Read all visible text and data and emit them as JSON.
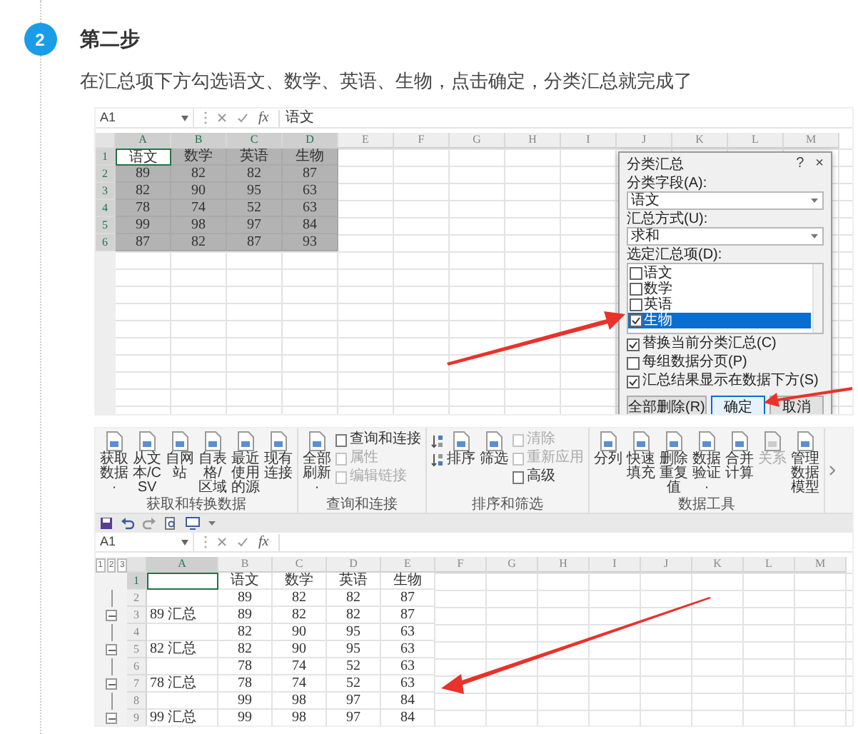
{
  "step": {
    "number": "2",
    "title": "第二步",
    "description": "在汇总项下方勾选语文、数学、英语、生物，点击确定，分类汇总就完成了"
  },
  "screenshot_1": {
    "formula_bar": {
      "name_box": "A1",
      "fx": "fx",
      "value": "语文"
    },
    "columns": [
      {
        "label": "A",
        "selected": true
      },
      {
        "label": "B",
        "selected": true
      },
      {
        "label": "C",
        "selected": true
      },
      {
        "label": "D",
        "selected": true
      },
      {
        "label": "E",
        "selected": false
      },
      {
        "label": "F",
        "selected": false
      },
      {
        "label": "G",
        "selected": false
      },
      {
        "label": "H",
        "selected": false
      },
      {
        "label": "I",
        "selected": false
      },
      {
        "label": "J",
        "selected": false
      },
      {
        "label": "K",
        "selected": false
      },
      {
        "label": "L",
        "selected": false
      },
      {
        "label": "M",
        "selected": false
      }
    ],
    "rows": [
      {
        "num": "1",
        "selected": true,
        "active": true,
        "cells": [
          "语文",
          "数学",
          "英语",
          "生物"
        ]
      },
      {
        "num": "2",
        "selected": true,
        "active": false,
        "cells": [
          "89",
          "82",
          "82",
          "87"
        ]
      },
      {
        "num": "3",
        "selected": true,
        "active": false,
        "cells": [
          "82",
          "90",
          "95",
          "63"
        ]
      },
      {
        "num": "4",
        "selected": true,
        "active": false,
        "cells": [
          "78",
          "74",
          "52",
          "63"
        ]
      },
      {
        "num": "5",
        "selected": true,
        "active": false,
        "cells": [
          "99",
          "98",
          "97",
          "84"
        ]
      },
      {
        "num": "6",
        "selected": true,
        "active": false,
        "cells": [
          "87",
          "82",
          "87",
          "93"
        ]
      }
    ],
    "dialog": {
      "title": "分类汇总",
      "help": "?",
      "close": "×",
      "field_label": "分类字段(A):",
      "field_value": "语文",
      "method_label": "汇总方式(U):",
      "method_value": "求和",
      "items_label": "选定汇总项(D):",
      "items": [
        {
          "label": "语文",
          "checked": false,
          "selected": false
        },
        {
          "label": "数学",
          "checked": false,
          "selected": false
        },
        {
          "label": "英语",
          "checked": false,
          "selected": false
        },
        {
          "label": "生物",
          "checked": true,
          "selected": true
        }
      ],
      "options": [
        {
          "label": "替换当前分类汇总(C)",
          "checked": true
        },
        {
          "label": "每组数据分页(P)",
          "checked": false
        },
        {
          "label": "汇总结果显示在数据下方(S)",
          "checked": true
        }
      ],
      "buttons": [
        {
          "label": "全部删除(R)",
          "selected": false
        },
        {
          "label": "确定",
          "selected": true
        },
        {
          "label": "取消",
          "selected": false
        }
      ]
    }
  },
  "screenshot_2": {
    "ribbon": {
      "groups": [
        {
          "label": "获取和转换数据",
          "items": [
            {
              "kind": "large",
              "label": "获取数据·",
              "disabled": false
            },
            {
              "kind": "large",
              "label": "从文本/CSV",
              "disabled": false
            },
            {
              "kind": "large",
              "label": "自网站",
              "disabled": false
            },
            {
              "kind": "large",
              "label": "自表格/区域",
              "disabled": false
            },
            {
              "kind": "large",
              "label": "最近使用的源",
              "disabled": false
            },
            {
              "kind": "large",
              "label": "现有连接",
              "disabled": false
            }
          ]
        },
        {
          "label": "查询和连接",
          "items": [
            {
              "kind": "large",
              "label": "全部刷新·",
              "disabled": false
            },
            {
              "kind": "small",
              "label": "查询和连接",
              "disabled": false
            },
            {
              "kind": "small",
              "label": "属性",
              "disabled": true
            },
            {
              "kind": "small",
              "label": "编辑链接",
              "disabled": true
            }
          ]
        },
        {
          "label": "排序和筛选",
          "items": [
            {
              "kind": "sort"
            },
            {
              "kind": "large",
              "label": "排序",
              "disabled": false
            },
            {
              "kind": "large",
              "label": "筛选",
              "disabled": false
            },
            {
              "kind": "small",
              "label": "清除",
              "disabled": true
            },
            {
              "kind": "small",
              "label": "重新应用",
              "disabled": true
            },
            {
              "kind": "small",
              "label": "高级",
              "disabled": false
            }
          ]
        },
        {
          "label": "数据工具",
          "items": [
            {
              "kind": "large",
              "label": "分列",
              "disabled": false
            },
            {
              "kind": "large",
              "label": "快速填充",
              "disabled": false
            },
            {
              "kind": "large",
              "label": "删除重复值",
              "disabled": false
            },
            {
              "kind": "large",
              "label": "数据验证·",
              "disabled": false
            },
            {
              "kind": "large",
              "label": "合并计算",
              "disabled": false
            },
            {
              "kind": "large",
              "label": "关系",
              "disabled": true
            },
            {
              "kind": "large",
              "label": "管理数据模型",
              "disabled": false
            }
          ]
        }
      ]
    },
    "formula_bar": {
      "name_box": "A1",
      "fx": "fx"
    },
    "outline_levels": [
      "1",
      "2",
      "3"
    ],
    "columns": [
      {
        "label": "A",
        "selected": true
      },
      {
        "label": "B",
        "selected": false
      },
      {
        "label": "C",
        "selected": false
      },
      {
        "label": "D",
        "selected": false
      },
      {
        "label": "E",
        "selected": false
      },
      {
        "label": "F",
        "selected": false
      },
      {
        "label": "G",
        "selected": false
      },
      {
        "label": "H",
        "selected": false
      },
      {
        "label": "I",
        "selected": false
      },
      {
        "label": "J",
        "selected": false
      },
      {
        "label": "K",
        "selected": false
      },
      {
        "label": "L",
        "selected": false
      },
      {
        "label": "M",
        "selected": false
      }
    ],
    "rows": [
      {
        "num": "1",
        "kind": "header",
        "selected": true,
        "values": [
          "语文",
          "数学",
          "英语",
          "生物"
        ]
      },
      {
        "num": "2",
        "kind": "detail",
        "selected": false,
        "values": [
          "89",
          "82",
          "82",
          "87"
        ]
      },
      {
        "num": "3",
        "kind": "summary",
        "selected": false,
        "label": "89 汇总",
        "values": [
          "89",
          "82",
          "82",
          "87"
        ]
      },
      {
        "num": "4",
        "kind": "detail",
        "selected": false,
        "values": [
          "82",
          "90",
          "95",
          "63"
        ]
      },
      {
        "num": "5",
        "kind": "summary",
        "selected": false,
        "label": "82 汇总",
        "values": [
          "82",
          "90",
          "95",
          "63"
        ]
      },
      {
        "num": "6",
        "kind": "detail",
        "selected": false,
        "values": [
          "78",
          "74",
          "52",
          "63"
        ]
      },
      {
        "num": "7",
        "kind": "summary",
        "selected": false,
        "label": "78 汇总",
        "values": [
          "78",
          "74",
          "52",
          "63"
        ]
      },
      {
        "num": "8",
        "kind": "detail",
        "selected": false,
        "values": [
          "99",
          "98",
          "97",
          "84"
        ]
      },
      {
        "num": "9",
        "kind": "summary",
        "selected": false,
        "label": "99 汇总",
        "values": [
          "99",
          "98",
          "97",
          "84"
        ]
      }
    ]
  }
}
